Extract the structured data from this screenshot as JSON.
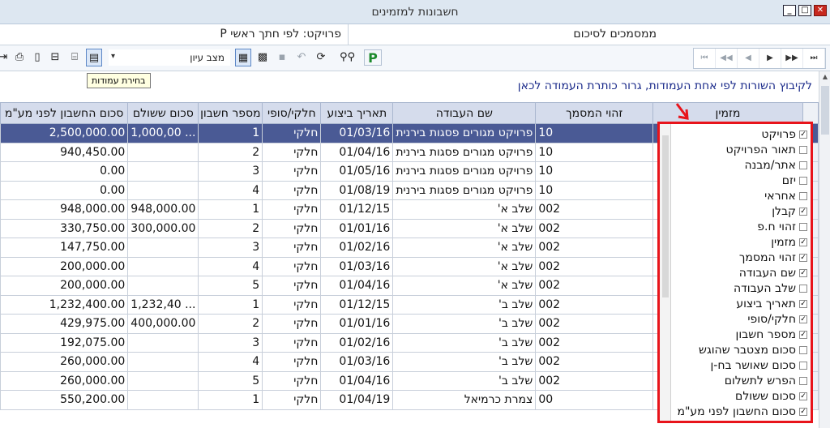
{
  "window": {
    "title": "חשבונות למזמינים",
    "buttons": [
      "_",
      "□",
      "✕"
    ]
  },
  "header": {
    "left_title": "פרויקט: לפי חתך ראשי P",
    "right_title": "ממסמכים לסיכום"
  },
  "toolbar": {
    "view_combo": "מצב עיון",
    "tooltip": "בחירת עמודות",
    "p_label": "P",
    "nav": [
      "⏮",
      "◀◀",
      "◀",
      "▶",
      "▶▶",
      "⏭"
    ]
  },
  "group_panel": {
    "text": "לקיבוץ השורות לפי אחת העמודות, גרור כותרת העמודה לכאן"
  },
  "grid": {
    "columns": [
      "סכום החשבון לפני מע\"מ",
      "סכום ששולם",
      "מספר חשבון",
      "חלקי/סופי",
      "תאריך ביצוע",
      "שם העבודה",
      "זהוי המסמך",
      "מזמין"
    ],
    "rows": [
      [
        "2,500,000.00",
        "1,000,00 ...",
        "1",
        "חלקי",
        "01/03/16",
        "פרויקט מגורים פסגות בירנית",
        "10"
      ],
      [
        "940,450.00",
        "",
        "2",
        "חלקי",
        "01/04/16",
        "פרויקט מגורים פסגות בירנית",
        "10"
      ],
      [
        "0.00",
        "",
        "3",
        "חלקי",
        "01/05/16",
        "פרויקט מגורים פסגות בירנית",
        "10"
      ],
      [
        "0.00",
        "",
        "4",
        "חלקי",
        "01/08/19",
        "פרויקט מגורים פסגות בירנית",
        "10"
      ],
      [
        "948,000.00",
        "948,000.00",
        "1",
        "חלקי",
        "01/12/15",
        "שלב א'",
        "002"
      ],
      [
        "330,750.00",
        "300,000.00",
        "2",
        "חלקי",
        "01/01/16",
        "שלב א'",
        "002"
      ],
      [
        "147,750.00",
        "",
        "3",
        "חלקי",
        "01/02/16",
        "שלב א'",
        "002"
      ],
      [
        "200,000.00",
        "",
        "4",
        "חלקי",
        "01/03/16",
        "שלב א'",
        "002"
      ],
      [
        "200,000.00",
        "",
        "5",
        "חלקי",
        "01/04/16",
        "שלב א'",
        "002"
      ],
      [
        "1,232,400.00",
        "1,232,40 ...",
        "1",
        "חלקי",
        "01/12/15",
        "שלב ב'",
        "002"
      ],
      [
        "429,975.00",
        "400,000.00",
        "2",
        "חלקי",
        "01/01/16",
        "שלב ב'",
        "002"
      ],
      [
        "192,075.00",
        "",
        "3",
        "חלקי",
        "01/02/16",
        "שלב ב'",
        "002"
      ],
      [
        "260,000.00",
        "",
        "4",
        "חלקי",
        "01/03/16",
        "שלב ב'",
        "002"
      ],
      [
        "260,000.00",
        "",
        "5",
        "חלקי",
        "01/04/16",
        "שלב ב'",
        "002"
      ],
      [
        "550,200.00",
        "",
        "1",
        "חלקי",
        "01/04/19",
        "צמרת כרמיאל",
        "00"
      ]
    ]
  },
  "column_chooser": {
    "items": [
      {
        "label": "פרויקט",
        "checked": true
      },
      {
        "label": "תאור הפרויקט",
        "checked": false
      },
      {
        "label": "אתר/מבנה",
        "checked": false
      },
      {
        "label": "יזם",
        "checked": false
      },
      {
        "label": "אחראי",
        "checked": false
      },
      {
        "label": "קבלן",
        "checked": true
      },
      {
        "label": "זהוי ח.פ",
        "checked": false
      },
      {
        "label": "מזמין",
        "checked": true
      },
      {
        "label": "זהוי המסמך",
        "checked": true
      },
      {
        "label": "שם העבודה",
        "checked": true
      },
      {
        "label": "שלב העבודה",
        "checked": false
      },
      {
        "label": "תאריך ביצוע",
        "checked": true
      },
      {
        "label": "חלקי/סופי",
        "checked": true
      },
      {
        "label": "מספר חשבון",
        "checked": true
      },
      {
        "label": "סכום מצטבר שהוגש",
        "checked": false
      },
      {
        "label": "סכום שאושר בח-ן",
        "checked": false
      },
      {
        "label": "הפרש לתשלום",
        "checked": false
      },
      {
        "label": "סכום ששולם",
        "checked": true
      },
      {
        "label": "סכום החשבון לפני מע\"מ",
        "checked": true
      }
    ]
  },
  "colors": {
    "selected_row": "#4a5a95",
    "header_bg": "#d5dcec",
    "highlight_border": "#e8141b",
    "group_text": "#1a2a8a"
  }
}
